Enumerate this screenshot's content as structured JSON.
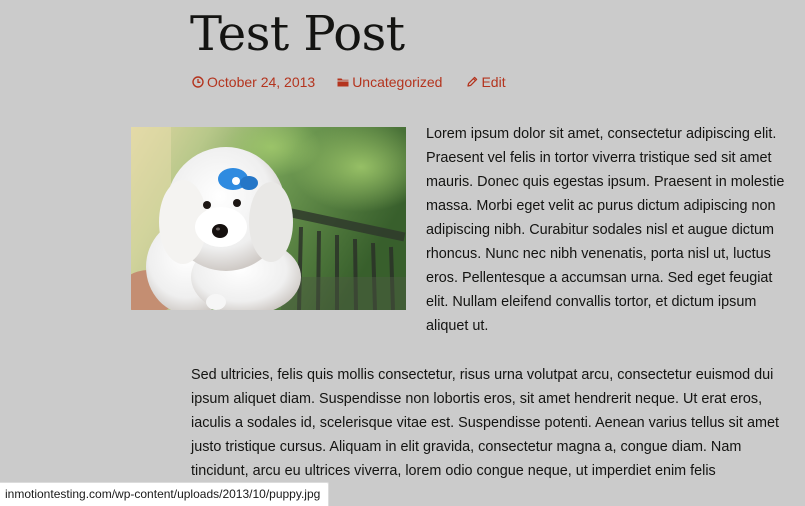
{
  "post": {
    "title": "Test Post",
    "meta": {
      "date": "October 24, 2013",
      "category": "Uncategorized",
      "edit_label": "Edit"
    },
    "paragraphs": [
      "Lorem ipsum dolor sit amet, consectetur adipiscing elit. Praesent vel felis in tortor viverra tristique sed sit amet mauris. Donec quis egestas ipsum. Praesent in molestie massa. Morbi eget velit ac purus dictum adip­iscing non adipiscing nibh. Curabitur sodales nisl et augue dictum rhoncus. Nunc nec nibh venenatis, porta nisl ut, luctus eros. Pellentesque a accumsan urna. Sed eget feugiat elit. Nullam eleifend convallis tortor, et dic­tum ipsum aliquet ut.",
      "Sed ultricies, felis quis mollis consectetur, risus urna volutpat arcu, consectetur euismod dui ipsum aliquet diam. Suspendisse non lobortis eros, sit amet hendrerit neque. Ut erat eros, iaculis a sodales id, scelerisque vitae est. Suspendisse potenti. Aenean varius tellus sit amet justo tristique cursus. Aliquam in elit gravida, consectetur magna a, congue diam. Nam tincidunt, arcu eu ultrices viverra, lorem odio congue neque, ut imperdiet enim felis"
    ]
  },
  "status_bar": {
    "url": "inmotiontesting.com/wp-content/uploads/2013/10/puppy.jpg"
  },
  "icons": {
    "date": "clock-icon",
    "category": "folder-icon",
    "edit": "pencil-icon"
  },
  "colors": {
    "background": "#cbcbcb",
    "meta_link": "#b4341e",
    "text": "#141412"
  }
}
